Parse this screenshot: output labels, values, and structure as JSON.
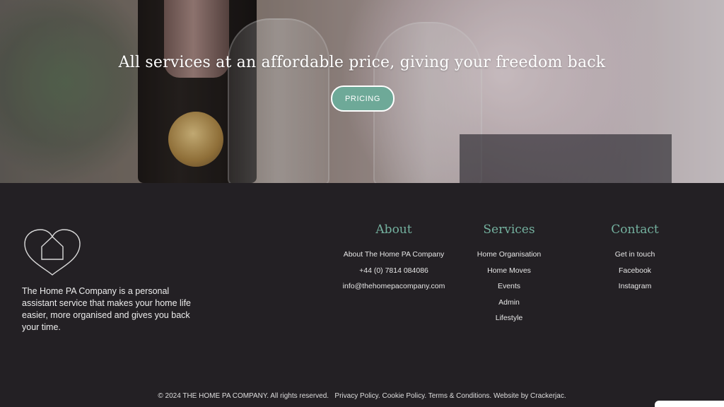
{
  "hero": {
    "title": "All services at an affordable price, giving your freedom back",
    "pricing_button": "PRICING"
  },
  "footer": {
    "description": "The Home PA Company is a personal assistant service that makes your home life easier, more organised and gives you back your time.",
    "about": {
      "heading": "About",
      "items": [
        "About The Home PA Company",
        "+44 (0) 7814 084086",
        "info@thehomepacompany.com"
      ]
    },
    "services": {
      "heading": "Services",
      "items": [
        "Home Organisation",
        "Home Moves",
        "Events",
        "Admin",
        "Lifestyle"
      ]
    },
    "contact": {
      "heading": "Contact",
      "items": [
        "Get in touch",
        "Facebook",
        "Instagram"
      ]
    },
    "copyright": "© 2024 THE HOME PA COMPANY. All rights reserved.",
    "legal_links": [
      "Privacy Policy.",
      "Cookie Policy.",
      "Terms & Conditions.",
      "Website by Crackerjac."
    ]
  },
  "colors": {
    "accent": "#74b19f",
    "button": "#6ea998",
    "footer_bg": "#232024"
  },
  "icons": {
    "logo": "heart-house-logo"
  }
}
